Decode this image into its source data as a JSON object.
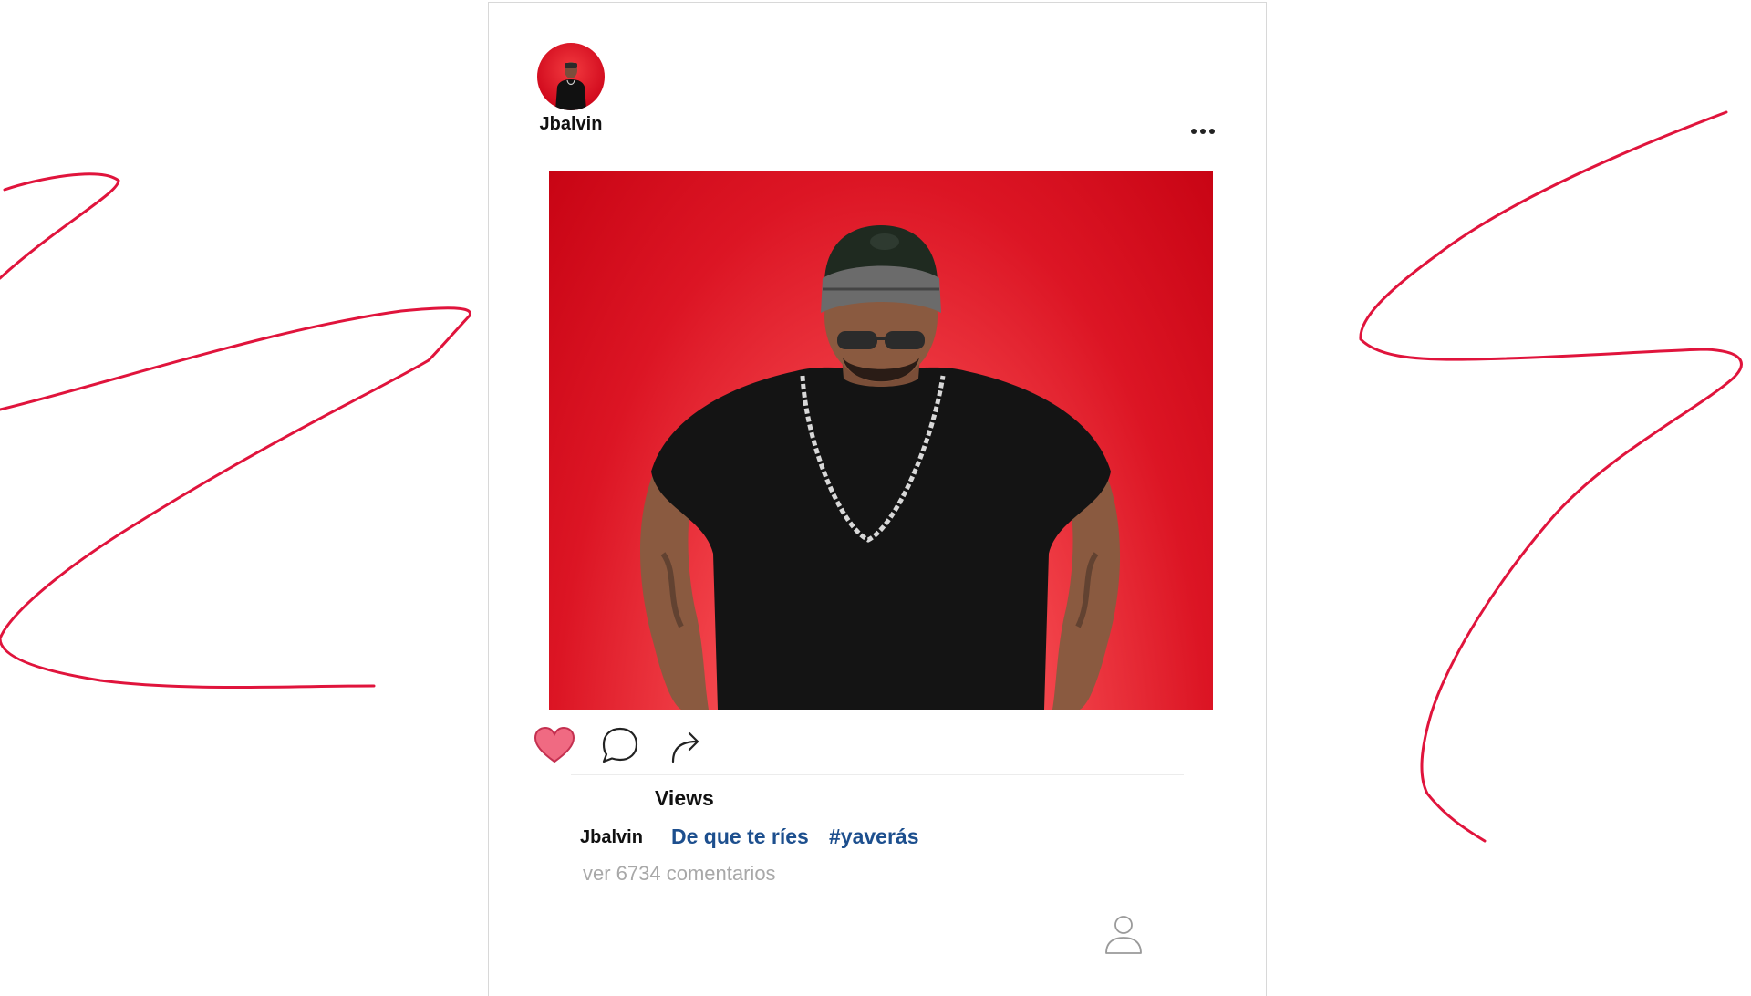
{
  "post": {
    "username": "Jbalvin",
    "views_label": "Views",
    "caption_username": "Jbalvin",
    "caption_text": "De que te ríes",
    "hashtag": "#yaverás",
    "comments_link": "ver 6734 comentarios",
    "liked": true
  },
  "icons": {
    "like": "heart-icon",
    "comment": "comment-bubble-icon",
    "share": "share-arrow-icon",
    "more": "more-options-icon",
    "profile": "user-profile-icon"
  },
  "colors": {
    "background": "#ffffff",
    "scribble": "#e0143c",
    "heart_fill": "#f06a82",
    "caption_link": "#1d4f8e",
    "photo_red": "#dc1524",
    "comments_gray": "#a8a8a8"
  }
}
